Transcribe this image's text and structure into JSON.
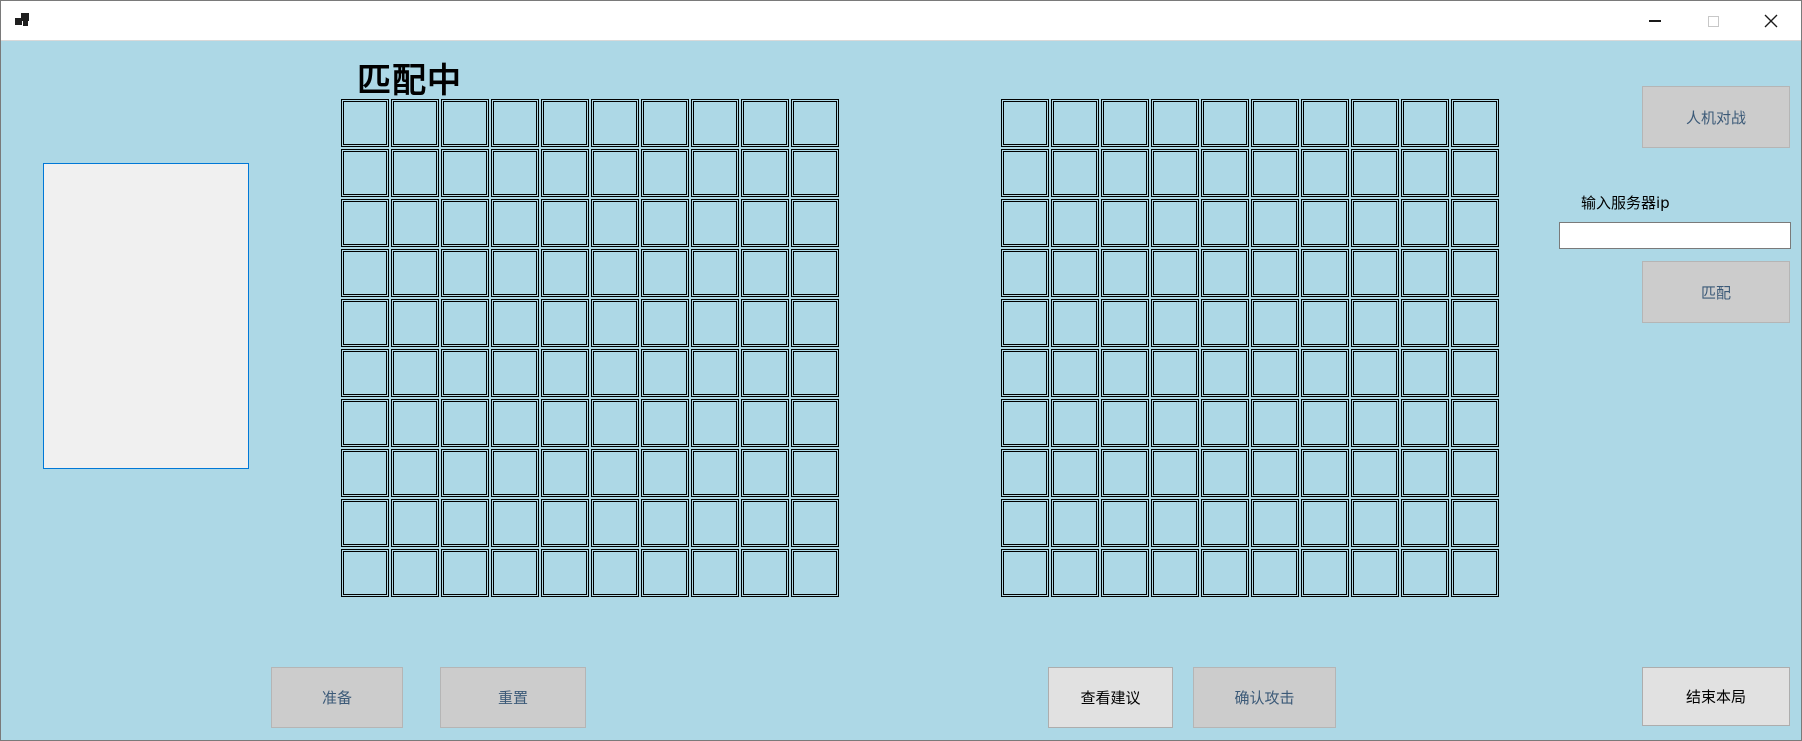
{
  "window": {
    "title": ""
  },
  "status": {
    "title": "匹配中"
  },
  "grids": {
    "rows": 10,
    "cols": 10
  },
  "buttons": {
    "vs_ai": "人机对战",
    "match": "匹配",
    "ready": "准备",
    "reset": "重置",
    "suggest": "查看建议",
    "confirm_attack": "确认攻击",
    "end_game": "结束本局"
  },
  "server": {
    "label": "输入服务器ip",
    "value": "",
    "placeholder": ""
  },
  "colors": {
    "background": "#add8e6",
    "button_disabled": "#cccccc",
    "button_enabled": "#e1e1e1"
  }
}
